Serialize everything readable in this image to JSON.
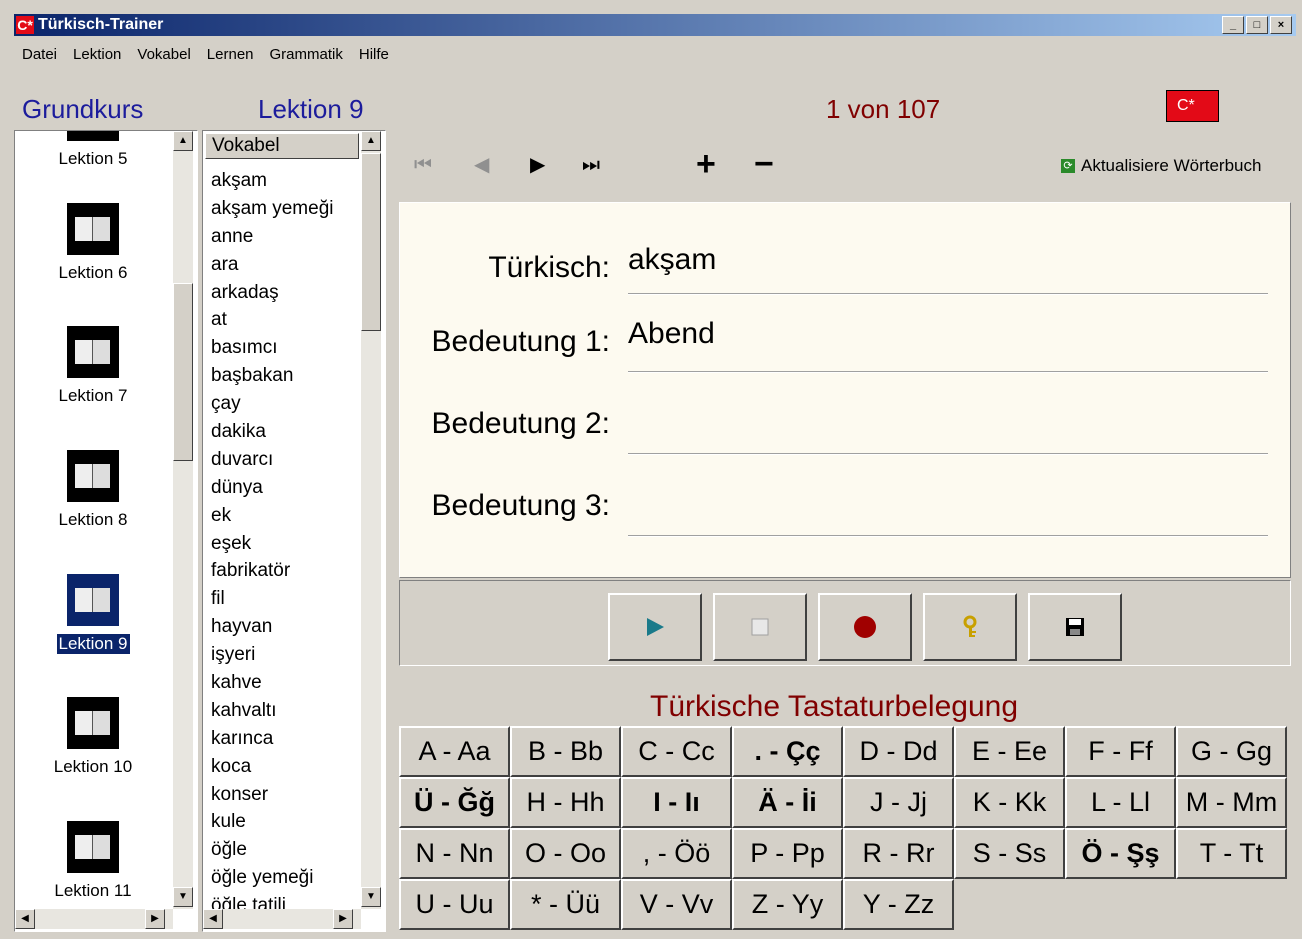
{
  "app": {
    "title": "Türkisch-Trainer",
    "icon": "C*"
  },
  "window_controls": {
    "minimize": "_",
    "maximize": "□",
    "close": "×"
  },
  "menu": [
    "Datei",
    "Lektion",
    "Vokabel",
    "Lernen",
    "Grammatik",
    "Hilfe"
  ],
  "header": {
    "course": "Grundkurs",
    "lesson": "Lektion 9",
    "counter": "1 von 107",
    "flag": "C*"
  },
  "lessons": [
    {
      "label": "Lektion 5",
      "selected": false
    },
    {
      "label": "Lektion 6",
      "selected": false
    },
    {
      "label": "Lektion 7",
      "selected": false
    },
    {
      "label": "Lektion 8",
      "selected": false
    },
    {
      "label": "Lektion 9",
      "selected": true
    },
    {
      "label": "Lektion 10",
      "selected": false
    },
    {
      "label": "Lektion 11",
      "selected": false
    }
  ],
  "vocab": {
    "header": "Vokabel",
    "items": [
      "akşam",
      "akşam yemeği",
      "anne",
      "ara",
      "arkadaş",
      "at",
      "basımcı",
      "başbakan",
      "çay",
      "dakika",
      "duvarcı",
      "dünya",
      "ek",
      "eşek",
      "fabrikatör",
      "fil",
      "hayvan",
      "işyeri",
      "kahve",
      "kahvaltı",
      "karınca",
      "koca",
      "konser",
      "kule",
      "öğle",
      "öğle yemeği",
      "öğle tatili"
    ]
  },
  "toolbar": {
    "refresh": "Aktualisiere Wörterbuch",
    "plus": "+",
    "minus": "−"
  },
  "form": {
    "turkish_label": "Türkisch:",
    "turkish_value": "akşam",
    "meaning1_label": "Bedeutung 1:",
    "meaning1_value": "Abend",
    "meaning2_label": "Bedeutung 2:",
    "meaning2_value": "",
    "meaning3_label": "Bedeutung 3:",
    "meaning3_value": ""
  },
  "keyboard": {
    "title": "Türkische Tastaturbelegung",
    "keys": [
      {
        "label": "A - Aa",
        "bold": false
      },
      {
        "label": "B - Bb",
        "bold": false
      },
      {
        "label": "C - Cc",
        "bold": false
      },
      {
        "label": ". - Çç",
        "bold": true
      },
      {
        "label": "D - Dd",
        "bold": false
      },
      {
        "label": "E - Ee",
        "bold": false
      },
      {
        "label": "F - Ff",
        "bold": false
      },
      {
        "label": "G - Gg",
        "bold": false
      },
      {
        "label": "Ü - Ğğ",
        "bold": true
      },
      {
        "label": "H - Hh",
        "bold": false
      },
      {
        "label": "I - Iı",
        "bold": true
      },
      {
        "label": "Ä - İi",
        "bold": true
      },
      {
        "label": "J - Jj",
        "bold": false
      },
      {
        "label": "K - Kk",
        "bold": false
      },
      {
        "label": "L - Ll",
        "bold": false
      },
      {
        "label": "M - Mm",
        "bold": false
      },
      {
        "label": "N - Nn",
        "bold": false
      },
      {
        "label": "O - Oo",
        "bold": false
      },
      {
        "label": ", - Öö",
        "bold": false
      },
      {
        "label": "P - Pp",
        "bold": false
      },
      {
        "label": "R - Rr",
        "bold": false
      },
      {
        "label": "S - Ss",
        "bold": false
      },
      {
        "label": "Ö - Şş",
        "bold": true
      },
      {
        "label": "T - Tt",
        "bold": false
      },
      {
        "label": "U - Uu",
        "bold": false
      },
      {
        "label": "* - Üü",
        "bold": false
      },
      {
        "label": "V - Vv",
        "bold": false
      },
      {
        "label": "Z - Yy",
        "bold": false
      },
      {
        "label": "Y - Zz",
        "bold": false
      }
    ]
  },
  "colors": {
    "accent_blue": "#1c1c9c",
    "accent_red": "#800000",
    "flag_red": "#e30a17",
    "selection": "#0a246a"
  }
}
